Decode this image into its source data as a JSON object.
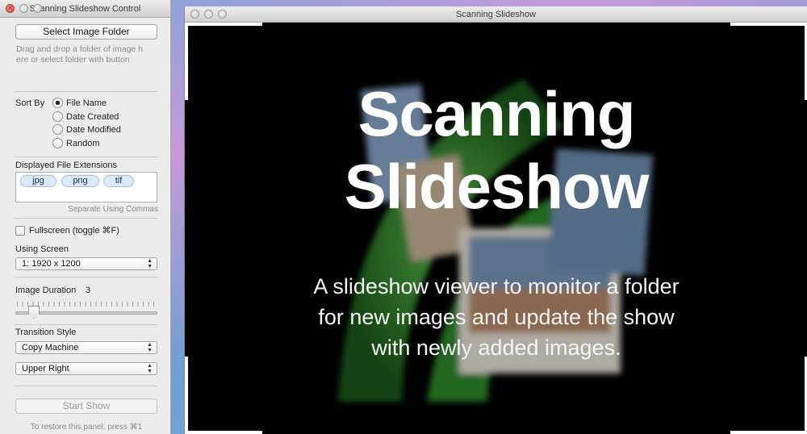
{
  "control_window": {
    "title": "Scanning Slideshow Control",
    "select_folder_button": "Select Image Folder",
    "drop_hint_line1": "Drag and drop a folder of image h",
    "drop_hint_line2": "ere or select folder with button",
    "sort_by_label": "Sort By",
    "sort_options": [
      "File Name",
      "Date Created",
      "Date Modified",
      "Random"
    ],
    "sort_selected": "File Name",
    "extensions_label": "Displayed File Extensions",
    "extensions": [
      "jpg",
      "png",
      "tif"
    ],
    "extensions_hint": "Separate Using Commas",
    "fullscreen_label": "Fullscreen (toggle ⌘F)",
    "fullscreen_checked": false,
    "screen_label": "Using Screen",
    "screen_value": "1: 1920 x 1200",
    "duration_label": "Image Duration",
    "duration_value": "3",
    "duration_slider_fraction": 0.1,
    "transition_label": "Transition Style",
    "transition_value": "Copy Machine",
    "transition_direction": "Upper Right",
    "start_button": "Start Show",
    "restore_hint": "To restore this panel, press ⌘1"
  },
  "slideshow_window": {
    "title": "Scanning Slideshow",
    "headline_line1": "Scanning",
    "headline_line2": "Slideshow",
    "subtitle_line1": "A slideshow viewer to monitor a folder",
    "subtitle_line2": "for new images and update the show",
    "subtitle_line3": "with newly added images."
  },
  "colors": {
    "accent_green": "#3fa23a",
    "token_bg": "#dde8f8",
    "close_red": "#e0443d"
  }
}
